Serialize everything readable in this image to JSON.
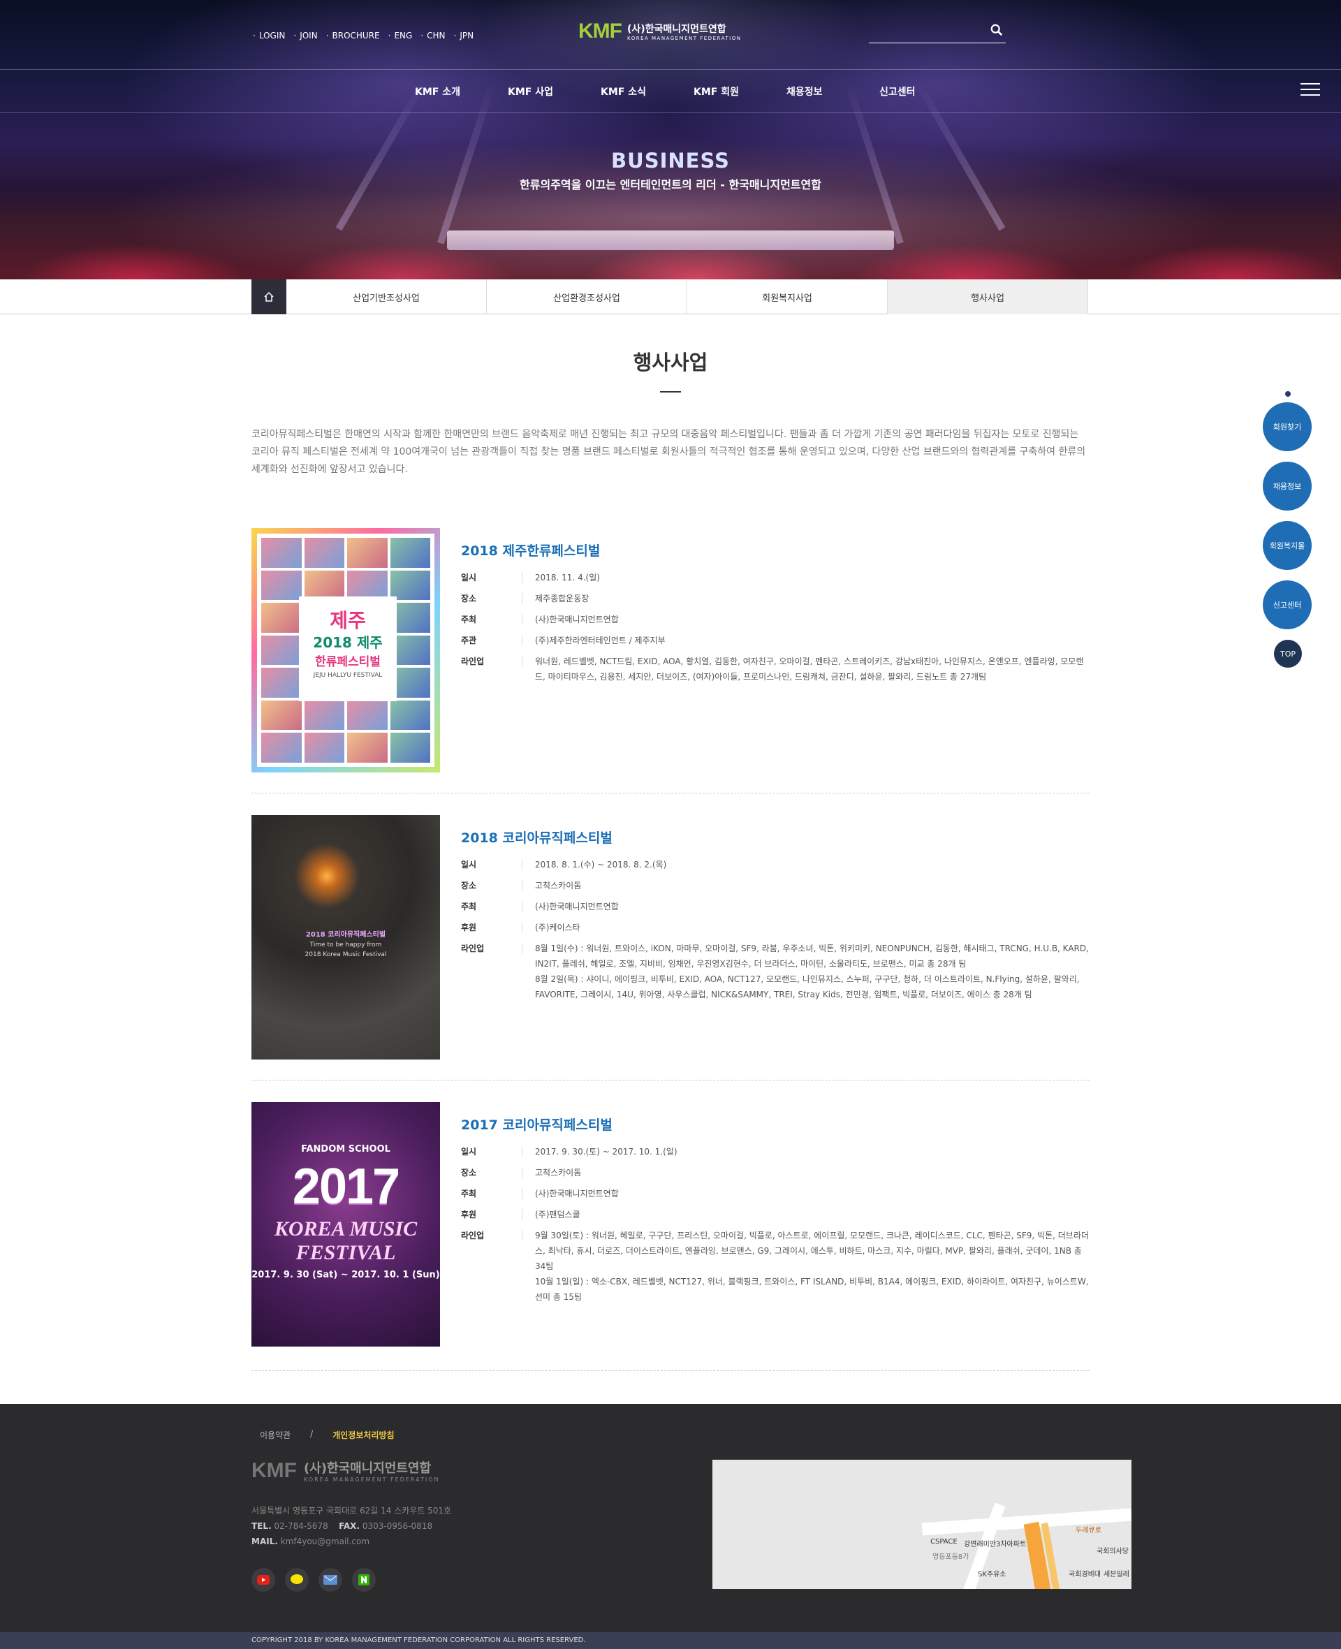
{
  "header": {
    "util_links": [
      "LOGIN",
      "JOIN",
      "BROCHURE",
      "ENG",
      "CHN",
      "JPN"
    ],
    "logo_mark": "KMF",
    "logo_kr": "(사)한국매니지먼트연합",
    "logo_en": "KOREA MANAGEMENT FEDERATION",
    "search_value": ""
  },
  "gnb": [
    "KMF 소개",
    "KMF 사업",
    "KMF 소식",
    "KMF 회원",
    "채용정보",
    "신고센터"
  ],
  "visual": {
    "title": "BUSINESS",
    "subtitle": "한류의주역을 이끄는 엔터테인먼트의 리더 - 한국매니지먼트연합"
  },
  "subnav": {
    "tabs": [
      "산업기반조성사업",
      "산업환경조성사업",
      "회원복지사업",
      "행사사업"
    ],
    "active_index": 3
  },
  "page": {
    "title": "행사사업",
    "intro": "코리아뮤직페스티벌은 한매연의 시작과 함께한 한매연만의 브랜드 음악축제로 매년 진행되는 최고 규모의 대중음악 페스티벌입니다. 팬들과 좀 더 가깝게 기존의 공연 패러다임을 뒤집자는 모토로 진행되는 코리아 뮤직 페스티벌은 전세계 약 100여개국이 넘는 관광객들이 직접 찾는 명품 브랜드 페스티벌로 회원사들의 적극적인 협조를 통해 운영되고 있으며, 다양한 산업 브랜드와의 협력관계를 구축하여 한류의 세계화와 선진화에 앞장서고 있습니다."
  },
  "events": [
    {
      "title": "2018 제주한류페스티벌",
      "poster": {
        "big": "제주",
        "year_title": "2018 제주",
        "sub": "한류페스티벌",
        "en": "JEJU HALLYU FESTIVAL"
      },
      "rows": [
        {
          "label": "일시",
          "value": "2018. 11. 4.(일)"
        },
        {
          "label": "장소",
          "value": "제주종합운동장"
        },
        {
          "label": "주최",
          "value": "(사)한국매니지먼트연합"
        },
        {
          "label": "주관",
          "value": "(주)제주한라엔터테인먼트 / 제주지부"
        },
        {
          "label": "라인업",
          "value": "워너원, 레드벨벳, NCT드림, EXID, AOA, 황치열, 김동한, 여자친구, 오마이걸, 펜타곤, 스트레이키즈, 강남x태진아, 나인뮤지스, 온앤오프, 엔플라잉, 모모랜드, 마이티마우스, 김용진, 세지안, 더보이즈, (여자)아이들, 프로미스나인, 드림캐쳐, 금잔디, 설하윤, 팔와리, 드림노트 총 27개팀"
        }
      ]
    },
    {
      "title": "2018 코리아뮤직페스티벌",
      "poster": {
        "line1": "Time to be happy from",
        "line2": "2018 Korea Music Festival"
      },
      "rows": [
        {
          "label": "일시",
          "value": "2018. 8. 1.(수) ~ 2018. 8. 2.(목)"
        },
        {
          "label": "장소",
          "value": "고척스카이돔"
        },
        {
          "label": "주최",
          "value": "(사)한국매니지먼트연합"
        },
        {
          "label": "후원",
          "value": "(주)케이스타"
        },
        {
          "label": "라인업",
          "value": "8월 1일(수) : 워너원, 트와이스, iKON, 마마무, 오마이걸, SF9, 라붐, 우주소녀, 빅톤, 위키미키, NEONPUNCH, 김동한, 해시태그, TRCNG, H.U.B, KARD, IN2IT, 플레쉬, 헤일로, 조엘, 지비비, 임채언, 우진영X김현수, 더 브라더스, 마이틴, 소울라티도, 브로맨스, 미교 총 28개 팀\n8월 2일(목) : 샤이니, 에이핑크, 비투비, EXID, AOA, NCT127, 모모랜드, 나인뮤지스, 스누퍼, 구구단, 청하, 더 이스트라이트, N.Flying, 설하윤, 팔와리, FAVORITE, 그레이시, 14U, 위아영, 사우스클럽, NICK&SAMMY, TREI, Stray Kids, 전민경, 임팩트, 빅플로, 더보이즈, 에이스 총 28개 팀"
        }
      ]
    },
    {
      "title": "2017 코리아뮤직페스티벌",
      "poster": {
        "fandom": "FANDOM SCHOOL",
        "year": "2017",
        "name": "KOREA MUSIC FESTIVAL",
        "date": "2017. 9. 30 (Sat) ~ 2017. 10. 1 (Sun)"
      },
      "rows": [
        {
          "label": "일시",
          "value": "2017. 9. 30.(토) ~ 2017. 10. 1.(일)"
        },
        {
          "label": "장소",
          "value": "고척스카이돔"
        },
        {
          "label": "주최",
          "value": "(사)한국매니지먼트연합"
        },
        {
          "label": "후원",
          "value": "(주)팬덤스쿨"
        },
        {
          "label": "라인업",
          "value": "9월 30일(토) : 워너원, 헤일로, 구구단, 프리스틴, 오마이걸, 빅플로, 아스트로, 에이프릴, 모모랜드, 크나큰, 레이디스코드, CLC, 펜타곤, SF9, 빅톤, 더브라더스, 최낙타, 휴시, 더로즈, 더이스트라이트, 엔플라잉, 브로맨스, G9, 그레이시, 에스투, 비하트, 마스크, 지수, 마릴다, MVP, 팔와리, 플래쉬, 굿데이, 1NB 총 34팀\n10월 1일(일) : 엑소-CBX, 레드벨벳, NCT127, 위너, 블랙핑크, 트와이스, FT ISLAND, 비투비, B1A4, 에이핑크, EXID, 하이라이트, 여자친구, 뉴이스트W, 선미 총 15팀"
        }
      ]
    }
  ],
  "quick_menu": [
    "회원찾기",
    "채용정보",
    "회원복지몰",
    "신고센터"
  ],
  "quick_top": "TOP",
  "footer": {
    "links": [
      "이용약관",
      "/",
      "개인정보처리방침"
    ],
    "logo_mark": "KMF",
    "logo_kr": "(사)한국매니지먼트연합",
    "logo_en": "KOREA MANAGEMENT FEDERATION",
    "address": "서울특별시 영등포구 국회대로 62길 14 스카우트 501호",
    "tel_label": "TEL.",
    "tel": "02-784-5678",
    "fax_label": "FAX.",
    "fax": "0303-0956-0818",
    "mail_label": "MAIL.",
    "mail": "kmf4you@gmail.com",
    "sns": [
      "youtube-icon",
      "kakaotalk-icon",
      "mail-icon",
      "naver-icon"
    ],
    "map_labels": [
      "CSPACE",
      "강변래미안3차아파트",
      "SK주유소",
      "국회의사당",
      "국회경비대",
      "세븐일레",
      "두레큐로",
      "영등포동8가"
    ],
    "copyright": "COPYRIGHT 2018 BY KOREA MANAGEMENT FEDERATION CORPORATION ALL RIGHTS RESERVED."
  },
  "colors": {
    "accent_blue": "#1f6db5",
    "title_blue": "#1a6eb7",
    "footer_bg": "#2b2b2d",
    "highlight": "#f2c744"
  }
}
